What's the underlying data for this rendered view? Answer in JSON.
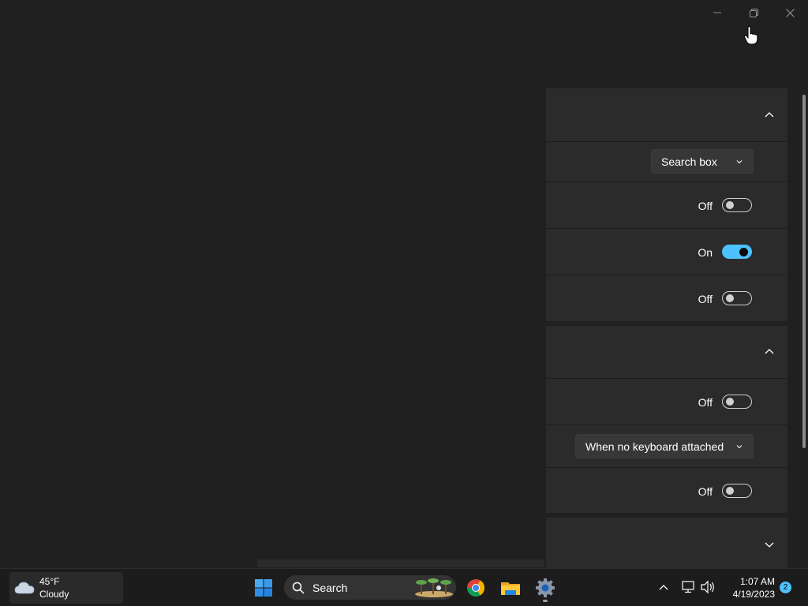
{
  "window": {
    "minimize_icon": "minimize-icon",
    "restore_icon": "restore-icon",
    "close_icon": "close-icon"
  },
  "settings": {
    "group1": {
      "expanded": true,
      "rows": [
        {
          "type": "dropdown",
          "value": "Search box"
        },
        {
          "type": "toggle",
          "state": "Off",
          "on": false
        },
        {
          "type": "toggle",
          "state": "On",
          "on": true
        },
        {
          "type": "toggle",
          "state": "Off",
          "on": false
        }
      ]
    },
    "group2": {
      "expanded": true,
      "rows": [
        {
          "type": "toggle",
          "state": "Off",
          "on": false
        },
        {
          "type": "dropdown",
          "value": "When no keyboard attached"
        },
        {
          "type": "toggle",
          "state": "Off",
          "on": false
        }
      ]
    },
    "group3": {
      "expanded": false
    }
  },
  "taskbar": {
    "weather": {
      "temp": "45°F",
      "condition": "Cloudy"
    },
    "search_label": "Search",
    "clock": {
      "time": "1:07 AM",
      "date": "4/19/2023"
    },
    "notification_count": "2"
  },
  "colors": {
    "accent": "#4cc2ff",
    "background": "#202020",
    "card": "#2b2b2b"
  }
}
